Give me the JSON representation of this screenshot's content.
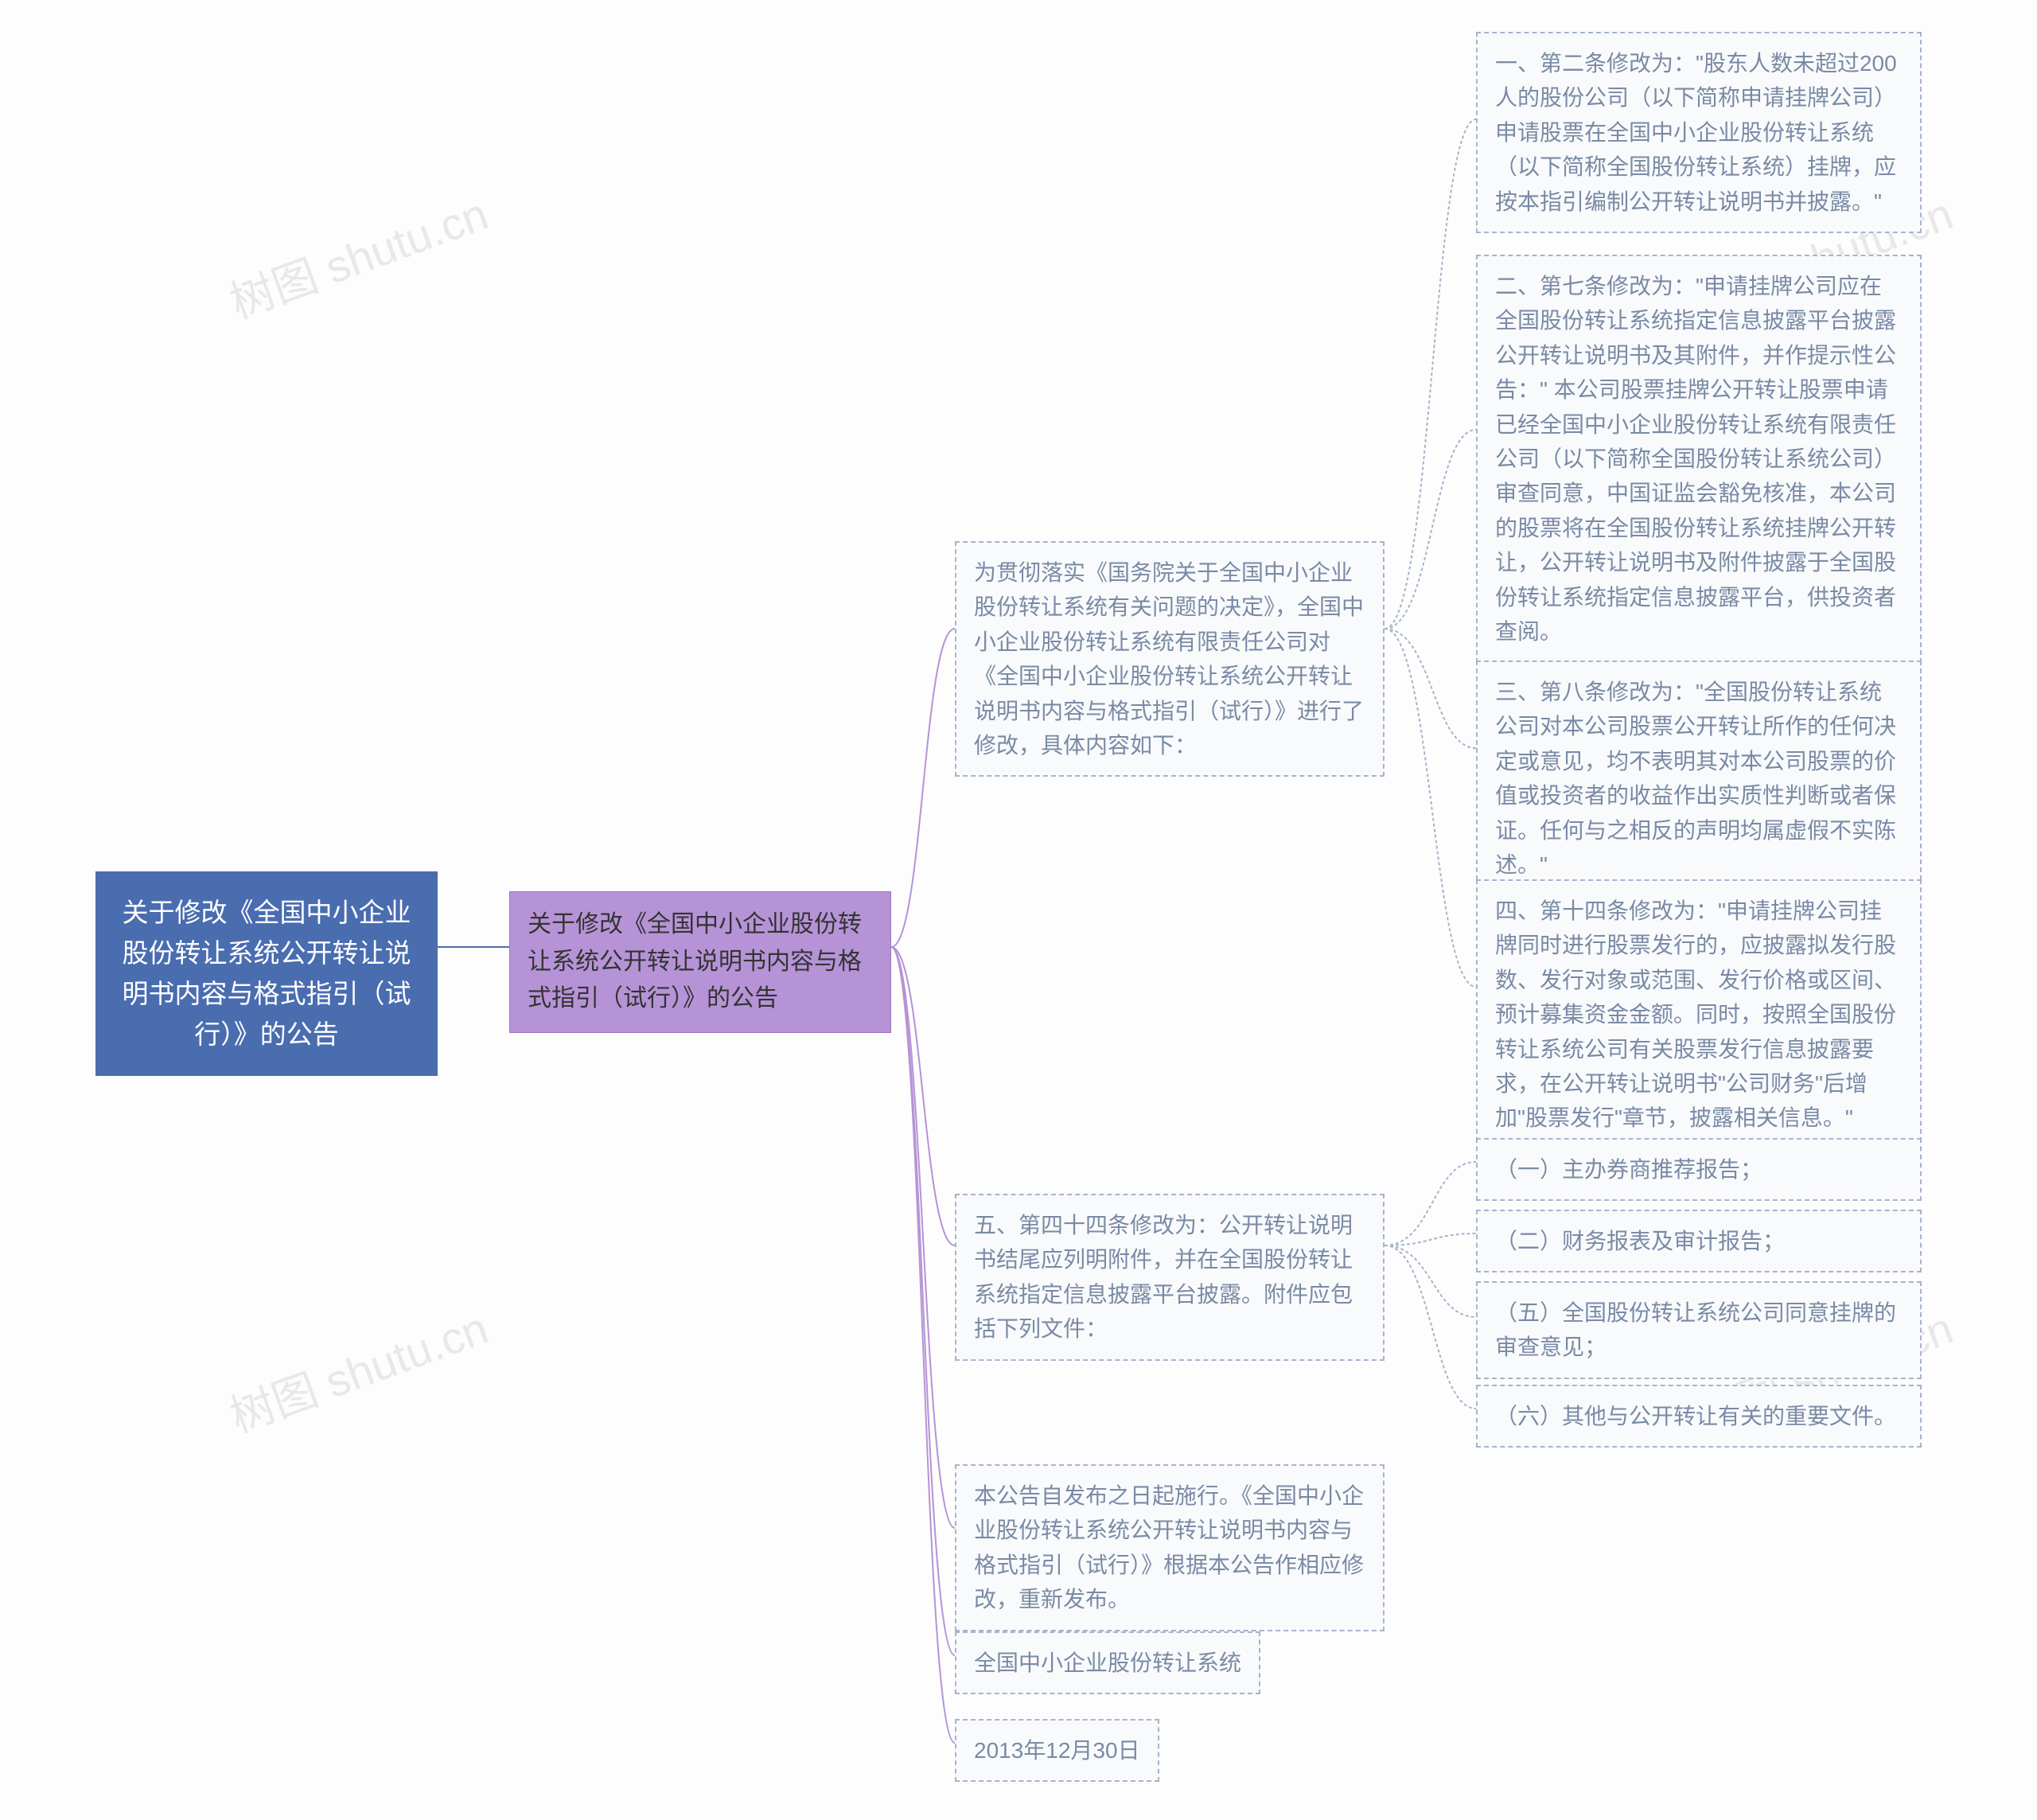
{
  "watermark": "树图 shutu.cn",
  "root": "关于修改《全国中小企业股份转让系统公开转让说明书内容与格式指引（试行）》的公告",
  "level2": "关于修改《全国中小企业股份转让系统公开转让说明书内容与格式指引（试行）》的公告",
  "level3": {
    "intro": "为贯彻落实《国务院关于全国中小企业股份转让系统有关问题的决定》，全国中小企业股份转让系统有限责任公司对《全国中小企业股份转让系统公开转让说明书内容与格式指引（试行）》进行了修改，具体内容如下：",
    "item5": "五、第四十四条修改为：公开转让说明书结尾应列明附件，并在全国股份转让系统指定信息披露平台披露。附件应包括下列文件：",
    "effective": "本公告自发布之日起施行。《全国中小企业股份转让系统公开转让说明书内容与格式指引（试行）》根据本公告作相应修改，重新发布。",
    "issuer": "全国中小企业股份转让系统",
    "date": "2013年12月30日"
  },
  "level4": {
    "a1": "一、第二条修改为：\"股东人数未超过200人的股份公司（以下简称申请挂牌公司）申请股票在全国中小企业股份转让系统（以下简称全国股份转让系统）挂牌，应按本指引编制公开转让说明书并披露。\"",
    "a2": "二、第七条修改为：\"申请挂牌公司应在全国股份转让系统指定信息披露平台披露公开转让说明书及其附件，并作提示性公告：\" 本公司股票挂牌公开转让股票申请已经全国中小企业股份转让系统有限责任公司（以下简称全国股份转让系统公司）审查同意，中国证监会豁免核准，本公司的股票将在全国股份转让系统挂牌公开转让，公开转让说明书及附件披露于全国股份转让系统指定信息披露平台，供投资者查阅。",
    "a3": "三、第八条修改为：\"全国股份转让系统公司对本公司股票公开转让所作的任何决定或意见，均不表明其对本公司股票的价值或投资者的收益作出实质性判断或者保证。任何与之相反的声明均属虚假不实陈述。\"",
    "a4": "四、第十四条修改为：\"申请挂牌公司挂牌同时进行股票发行的，应披露拟发行股数、发行对象或范围、发行价格或区间、预计募集资金金额。同时，按照全国股份转让系统公司有关股票发行信息披露要求，在公开转让说明书\"公司财务\"后增加\"股票发行\"章节，披露相关信息。\""
  },
  "level4b": {
    "b1": "（一）主办券商推荐报告；",
    "b2": "（二）财务报表及审计报告；",
    "b5": "（五）全国股份转让系统公司同意挂牌的审查意见；",
    "b6": "（六）其他与公开转让有关的重要文件。"
  }
}
